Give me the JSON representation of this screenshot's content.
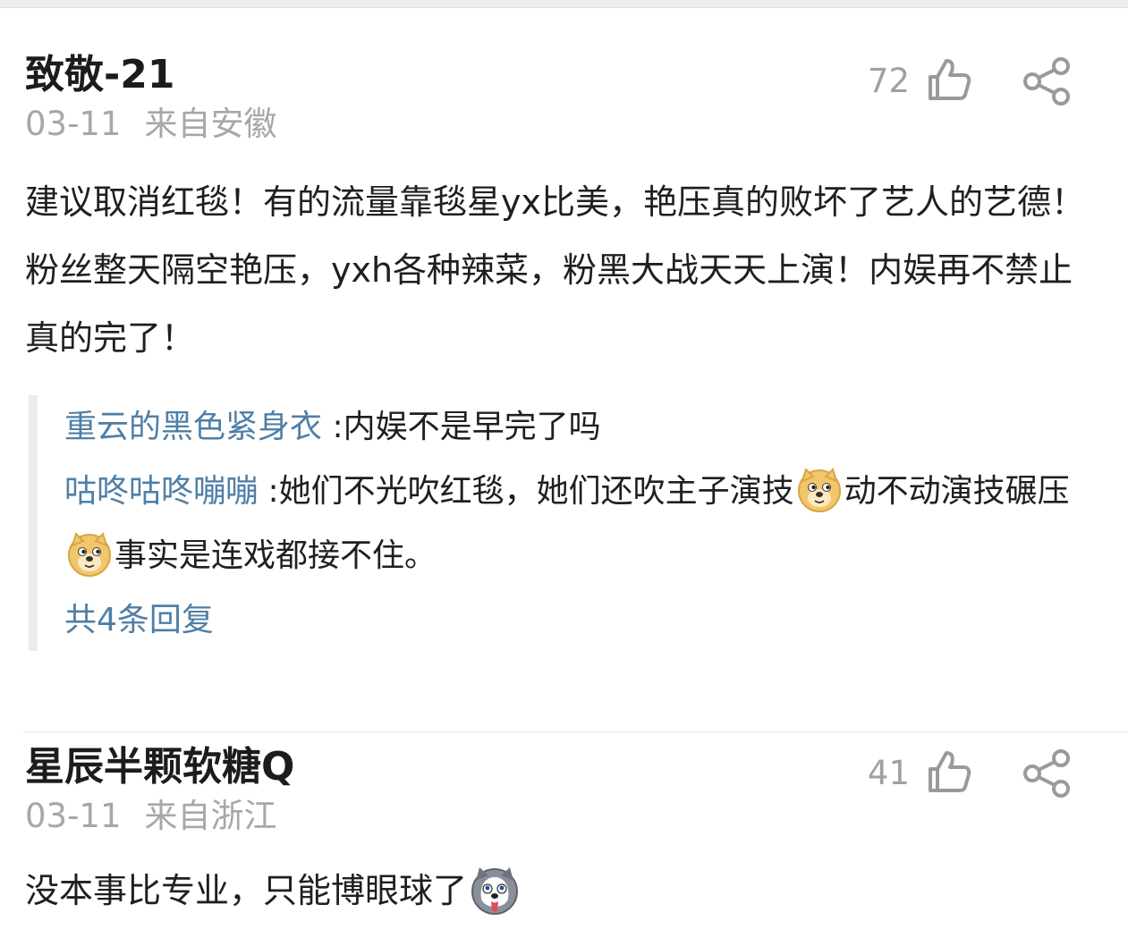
{
  "comments": [
    {
      "author": "致敬-21",
      "date": "03-11",
      "location": "来自安徽",
      "likes": "72",
      "text": "建议取消红毯！有的流量靠毯星yx比美，艳压真的败坏了艺人的艺德！粉丝整天隔空艳压，yxh各种辣菜，粉黑大战天天上演！内娱再不禁止真的完了！",
      "replies": [
        {
          "user": "重云的黑色紧身衣",
          "separator": ":",
          "text": "内娱不是早完了吗"
        },
        {
          "user": "咕咚咕咚嘣嘣",
          "separator": ":",
          "text_part1": "她们不光吹红毯，她们还吹主子演技",
          "text_part2": "动不动演技碾压",
          "text_part3": "事实是连戏都接不住。"
        }
      ],
      "more_replies": "共4条回复"
    },
    {
      "author": "星辰半颗软糖Q",
      "date": "03-11",
      "location": "来自浙江",
      "likes": "41",
      "text": "没本事比专业，只能博眼球了"
    }
  ],
  "icons": {
    "like": "thumbs-up-icon",
    "share": "share-icon",
    "emoji_doge": "doge-emoji",
    "emoji_husky": "husky-emoji"
  },
  "colors": {
    "author": "#1c1c1c",
    "meta": "#a7a7a7",
    "reply_user": "#4f7fa6",
    "reply_bar": "#ececec"
  }
}
